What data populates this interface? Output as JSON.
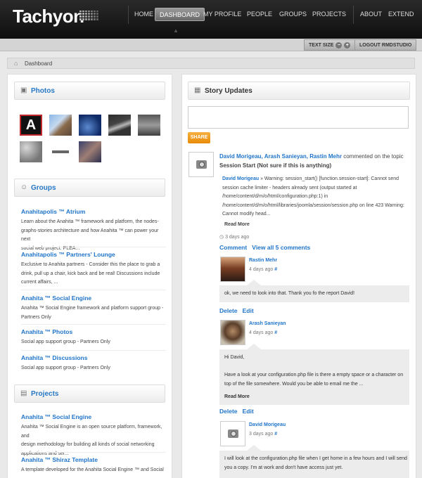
{
  "header": {
    "logo": "Tachyon",
    "nav": [
      "HOME",
      "DASHBOARD",
      "MY PROFILE",
      "PEOPLE",
      "GROUPS",
      "PROJECTS",
      "ABOUT",
      "EXTEND"
    ],
    "active_nav": "DASHBOARD"
  },
  "utility": {
    "text_size_label": "TEXT SIZE",
    "minus": "−",
    "plus": "+",
    "logout_label": "LOGOUT RMDSTUDIO"
  },
  "breadcrumb": {
    "label": "Dashboard"
  },
  "photos": {
    "title": "Photos"
  },
  "groups": {
    "title": "Groups",
    "items": [
      {
        "name": "Anahitapolis ™ Atrium",
        "desc": [
          "Learn about the Anahita ™ framework and platform, the nodes-",
          "graphs-stories architecture and how Anahita ™ can power your next",
          "social web project. PLEA..."
        ]
      },
      {
        "name": "Anahitapolis ™ Partners' Lounge",
        "desc": [
          "Exclusive to Anahita partners - Consider this the place to grab a",
          "drink, pull up a chair, kick back and be real! Discussions include",
          "current affairs, ..."
        ]
      },
      {
        "name": "Anahita ™ Social Engine",
        "desc": [
          "Anahita ™ Social Engine framework and platform support group -",
          "Partners Only"
        ]
      },
      {
        "name": "Anahita ™ Photos",
        "desc": [
          "Social app support group - Partners Only"
        ]
      },
      {
        "name": "Anahita ™ Discussions",
        "desc": [
          "Social app support group - Partners Only"
        ]
      }
    ]
  },
  "projects": {
    "title": "Projects",
    "items": [
      {
        "name": "Anahita ™ Social Engine",
        "desc": [
          "Anahita ™ Social Engine is an open source platform, framework, and",
          "design methodology for building all kinds of social networking",
          "applications and ser..."
        ]
      },
      {
        "name": "Anahita ™ Shiraz Template",
        "desc": [
          "A template developed for the Anahita Social Engine ™ and Social"
        ]
      }
    ]
  },
  "stories": {
    "title": "Story Updates",
    "share_label": "SHARE",
    "story": {
      "actors": "David Morigeau, Arash Sanieyan, Rastin Mehr",
      "verb": " commented on the topic",
      "topic": "Session Start (Not sure if this is anything)",
      "quote_author": "David Morigeau",
      "quote_lines": [
        " » Warning: session_start() [function.session-start]: Cannot send",
        "session cache limiter - headers already sent (output started at",
        "/home/content/d/m/o/html/configuration.php:1) in",
        "/home/content/d/m/o/html/libraries/joomla/session/session.php on line 423 Warning:",
        "Cannot modify head..."
      ],
      "read_more": "Read More",
      "time": "3 days ago",
      "comment_label": "Comment",
      "view_all": "View all 5 comments"
    },
    "comments": [
      {
        "name": "Rastin Mehr",
        "time": "4 days ago",
        "text": [
          "ok, we need to look into that. Thank you fo the report David!"
        ],
        "delete": "Delete",
        "edit": "Edit"
      },
      {
        "name": "Arash Sanieyan",
        "time": "4 days ago",
        "text": [
          "Hi David,",
          "",
          "Have a look at your configuration.php file is there a  empty space or a character on",
          "top of the file somewhere. Would you be able to email me the ..."
        ],
        "read_more": "Read More",
        "delete": "Delete",
        "edit": "Edit"
      },
      {
        "name": "David Morigeau",
        "time": "3 days ago",
        "text": [
          "I will look at the configuration.php file when I get home in a few hours and I will send",
          "you a copy. I'm at work and don't have access just yet."
        ]
      }
    ],
    "share_mark": "#"
  }
}
